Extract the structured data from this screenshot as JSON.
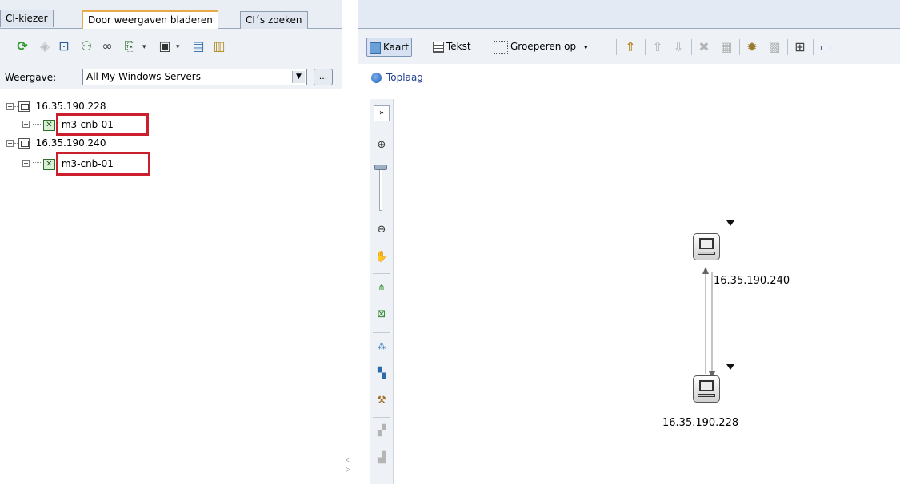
{
  "left_panel": {
    "tabs": [
      {
        "label": "CI-kiezer"
      },
      {
        "label": "Door weergaven bladeren"
      },
      {
        "label": "CI´s zoeken"
      }
    ],
    "toolbar_icons": [
      "refresh-icon",
      "show-icon",
      "filter-icon",
      "signal-icon",
      "link-icon",
      "import-icon",
      "save-icon",
      "report-icon",
      "properties-icon"
    ],
    "view_label": "Weergave:",
    "view_value": "All My Windows Servers",
    "view_more_label": "...",
    "tree": [
      {
        "label": "16.35.190.228",
        "icon": "server-icon",
        "children": [
          {
            "label": "m3-cnb-01",
            "icon": "cluster-icon",
            "highlighted": true
          }
        ]
      },
      {
        "label": "16.35.190.240",
        "icon": "server-icon",
        "children": [
          {
            "label": "m3-cnb-01",
            "icon": "cluster-icon",
            "highlighted": true
          }
        ]
      }
    ]
  },
  "right_panel": {
    "toolbar": {
      "map_label": "Kaart",
      "text_label": "Tekst",
      "group_label": "Groeperen op"
    },
    "breadcrumb": "Toplaag",
    "nodes": [
      {
        "label": "16.35.190.240",
        "icon": "server-icon"
      },
      {
        "label": "16.35.190.228",
        "icon": "server-icon"
      }
    ]
  },
  "colors": {
    "highlight": "#cc1f2e",
    "tab_active_border": "#e8a94a",
    "breadcrumb_text": "#1f3f8f"
  }
}
